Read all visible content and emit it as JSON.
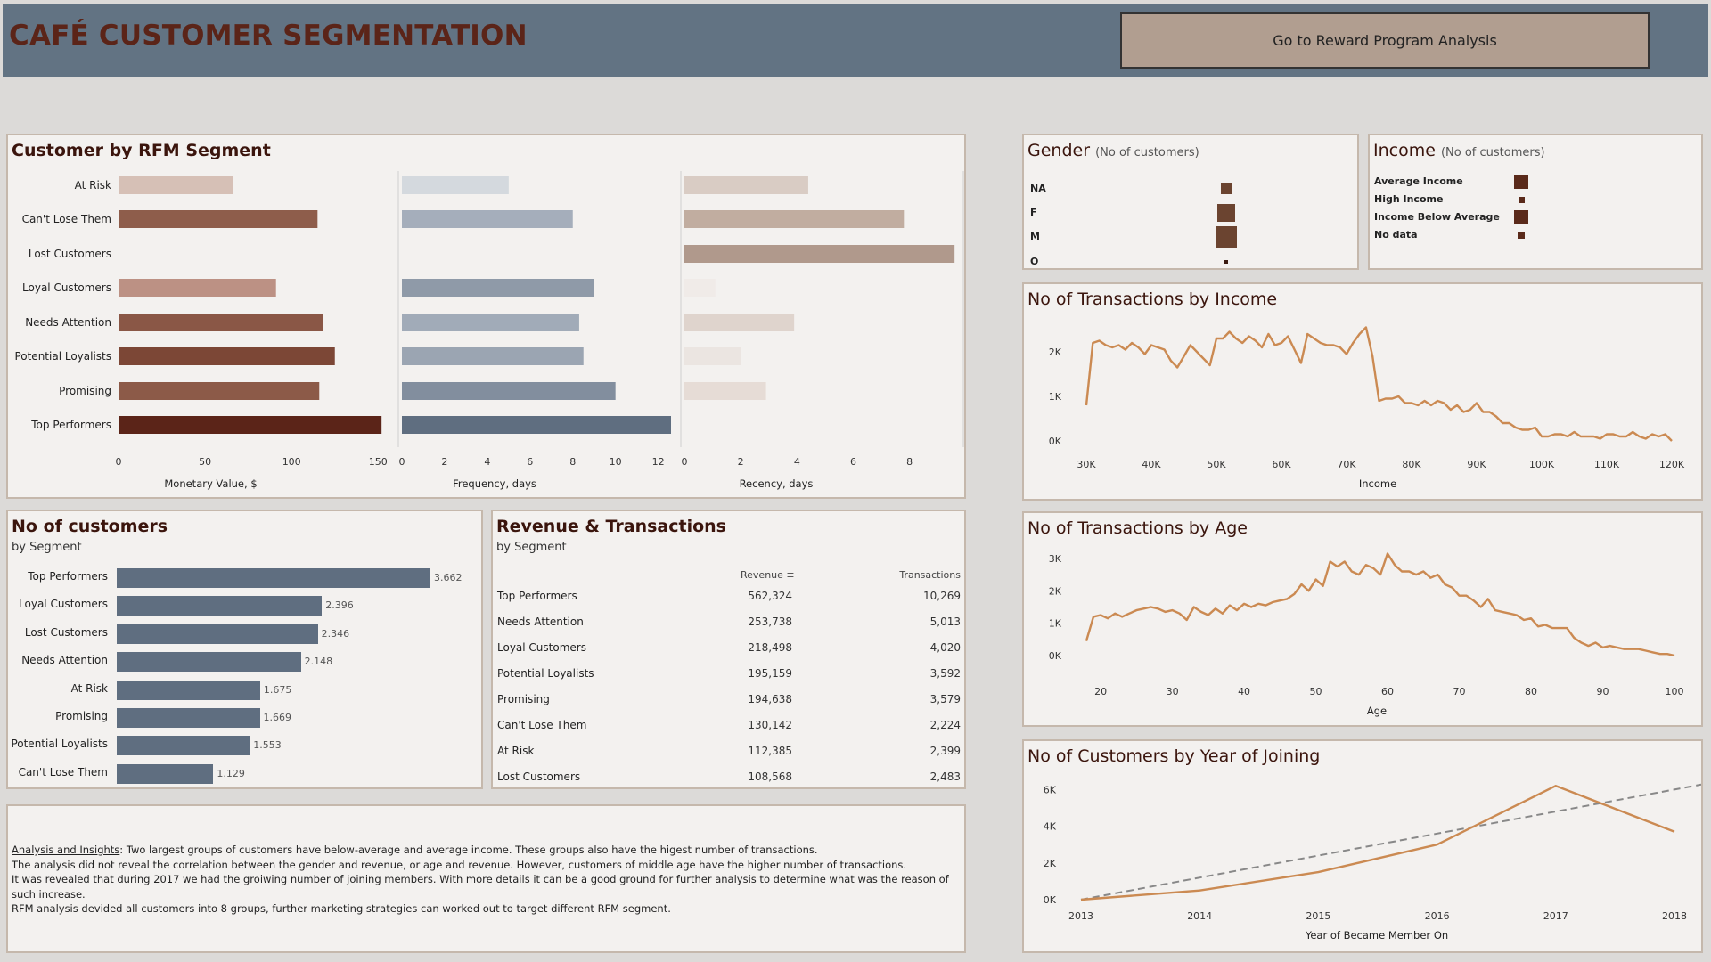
{
  "header": {
    "title": "CAFÉ CUSTOMER SEGMENTATION",
    "nav_button": "Go to Reward Program Analysis"
  },
  "rfm": {
    "title": "Customer by RFM Segment",
    "segments": [
      "At Risk",
      "Can't Lose Them",
      "Lost Customers",
      "Loyal Customers",
      "Needs Attention",
      "Potential Loyalists",
      "Promising",
      "Top Performers"
    ],
    "monetary": [
      66,
      115,
      0,
      91,
      118,
      125,
      116,
      152
    ],
    "frequency": [
      5,
      8,
      0,
      9,
      8.3,
      8.5,
      10,
      12.6
    ],
    "recency": [
      4.4,
      7.8,
      9.6,
      1.1,
      3.9,
      2,
      2.9,
      0
    ],
    "monetary_colors": [
      "#d6c0b6",
      "#8e5d4b",
      "#f3f1ef",
      "#bc9184",
      "#8a5746",
      "#7c4736",
      "#8c5a48",
      "#5b2418"
    ],
    "frequency_colors": [
      "#d4d9de",
      "#a5aebb",
      "#f3f1ef",
      "#8f9aa8",
      "#a1abb8",
      "#9ba5b2",
      "#828e9e",
      "#5f6e80"
    ],
    "recency_colors": [
      "#d9ccc4",
      "#c1ada0",
      "#b0998c",
      "#f0ebe8",
      "#dfd4cd",
      "#ebe5e1",
      "#e6dcd6",
      "#f3f1ef"
    ],
    "monetary_ticks": [
      "0",
      "50",
      "100",
      "150"
    ],
    "frequency_ticks": [
      "0",
      "2",
      "4",
      "6",
      "8",
      "10",
      "12"
    ],
    "recency_ticks": [
      "0",
      "2",
      "4",
      "6",
      "8"
    ],
    "monetary_label": "Monetary Value, $",
    "frequency_label": "Frequency, days",
    "recency_label": "Recency, days"
  },
  "gender": {
    "title": "Gender",
    "subtitle": "(No of customers)",
    "labels": [
      "NA",
      "F",
      "M",
      "O"
    ],
    "sizes": [
      12,
      20,
      24,
      4
    ]
  },
  "income": {
    "title": "Income",
    "subtitle": "(No of customers)",
    "labels": [
      "Average Income",
      "High Income",
      "Income Below Average",
      "No data"
    ],
    "sizes": [
      16,
      7,
      16,
      8
    ]
  },
  "tx_income": {
    "title": "No of Transactions by Income",
    "xlabel": "Income",
    "x_ticks": [
      "30K",
      "40K",
      "50K",
      "60K",
      "70K",
      "80K",
      "90K",
      "100K",
      "110K",
      "120K"
    ],
    "y_ticks": [
      "2K",
      "1K",
      "0K"
    ]
  },
  "tx_age": {
    "title": "No of Transactions by Age",
    "xlabel": "Age",
    "x_ticks": [
      "20",
      "30",
      "40",
      "50",
      "60",
      "70",
      "80",
      "90",
      "100"
    ],
    "y_ticks": [
      "3K",
      "2K",
      "1K",
      "0K"
    ]
  },
  "year_join": {
    "title": "No of Customers by Year of Joining",
    "xlabel": "Year of Became Member On",
    "x_ticks": [
      "2013",
      "2014",
      "2015",
      "2016",
      "2017",
      "2018"
    ],
    "y_ticks": [
      "6K",
      "4K",
      "2K",
      "0K"
    ]
  },
  "customers": {
    "title": "No of customers",
    "subtitle": "by Segment",
    "rows": [
      {
        "label": "Top Performers",
        "value": "3.662"
      },
      {
        "label": "Loyal Customers",
        "value": "2.396"
      },
      {
        "label": "Lost Customers",
        "value": "2.346"
      },
      {
        "label": "Needs Attention",
        "value": "2.148"
      },
      {
        "label": "At Risk",
        "value": "1.675"
      },
      {
        "label": "Promising",
        "value": "1.669"
      },
      {
        "label": "Potential Loyalists",
        "value": "1.553"
      },
      {
        "label": "Can't Lose Them",
        "value": "1.129"
      }
    ],
    "fractions": [
      1.0,
      0.654,
      0.641,
      0.587,
      0.457,
      0.456,
      0.424,
      0.308
    ]
  },
  "revenue": {
    "title": "Revenue & Transactions",
    "subtitle": "by Segment",
    "col_revenue": "Revenue",
    "col_transactions": "Transactions",
    "rows": [
      {
        "segment": "Top Performers",
        "revenue": "562,324",
        "transactions": "10,269"
      },
      {
        "segment": "Needs Attention",
        "revenue": "253,738",
        "transactions": "5,013"
      },
      {
        "segment": "Loyal Customers",
        "revenue": "218,498",
        "transactions": "4,020"
      },
      {
        "segment": "Potential Loyalists",
        "revenue": "195,159",
        "transactions": "3,592"
      },
      {
        "segment": "Promising",
        "revenue": "194,638",
        "transactions": "3,579"
      },
      {
        "segment": "Can't Lose Them",
        "revenue": "130,142",
        "transactions": "2,224"
      },
      {
        "segment": "At Risk",
        "revenue": "112,385",
        "transactions": "2,399"
      },
      {
        "segment": "Lost Customers",
        "revenue": "108,568",
        "transactions": "2,483"
      }
    ]
  },
  "insights": {
    "heading": "Analysis and Insights",
    "line1": ": Two largest groups of customers have below-average and average income. These groups also have the higest number of transactions.",
    "line2": "The analysis did not reveal the correlation between the gender and revenue, or age and revenue. However, customers of middle age have the higher number of transactions.",
    "line3": "It was revealed that during 2017 we had the groiwing number of joining members. With more details it can be a good ground for further analysis to determine what was the reason of such increase.",
    "line4": "RFM analysis devided all customers into 8 groups, further marketing strategies can worked out to target different RFM segment."
  },
  "chart_data": [
    {
      "type": "line",
      "title": "No of Transactions by Income",
      "xlabel": "Income",
      "x": [
        30000,
        31000,
        32000,
        33000,
        34000,
        35000,
        36000,
        37000,
        38000,
        39000,
        40000,
        41000,
        42000,
        43000,
        44000,
        45000,
        46000,
        47000,
        48000,
        49000,
        50000,
        51000,
        52000,
        53000,
        54000,
        55000,
        56000,
        57000,
        58000,
        59000,
        60000,
        61000,
        62000,
        63000,
        64000,
        65000,
        66000,
        67000,
        68000,
        69000,
        70000,
        71000,
        72000,
        73000,
        74000,
        75000,
        76000,
        77000,
        78000,
        79000,
        80000,
        81000,
        82000,
        83000,
        84000,
        85000,
        86000,
        87000,
        88000,
        89000,
        90000,
        91000,
        92000,
        93000,
        94000,
        95000,
        96000,
        97000,
        98000,
        99000,
        100000,
        101000,
        102000,
        103000,
        104000,
        105000,
        106000,
        107000,
        108000,
        109000,
        110000,
        111000,
        112000,
        113000,
        114000,
        115000,
        116000,
        117000,
        118000,
        119000,
        120000
      ],
      "y": [
        800,
        2200,
        2250,
        2150,
        2100,
        2150,
        2050,
        2200,
        2100,
        1950,
        2150,
        2100,
        2050,
        1800,
        1650,
        1900,
        2150,
        2000,
        1850,
        1700,
        2300,
        2300,
        2450,
        2300,
        2200,
        2350,
        2250,
        2100,
        2400,
        2150,
        2200,
        2350,
        2050,
        1750,
        2400,
        2300,
        2200,
        2150,
        2150,
        2100,
        1950,
        2200,
        2400,
        2550,
        1900,
        900,
        950,
        950,
        1000,
        850,
        850,
        800,
        900,
        800,
        900,
        850,
        700,
        800,
        650,
        700,
        850,
        650,
        650,
        550,
        400,
        400,
        300,
        250,
        250,
        300,
        100,
        100,
        150,
        150,
        100,
        200,
        100,
        100,
        100,
        50,
        150,
        150,
        100,
        100,
        200,
        100,
        50,
        150,
        100,
        150,
        0
      ],
      "ylim": [
        0,
        2800
      ]
    },
    {
      "type": "line",
      "title": "No of Transactions by Age",
      "xlabel": "Age",
      "x": [
        18,
        19,
        20,
        21,
        22,
        23,
        24,
        25,
        26,
        27,
        28,
        29,
        30,
        31,
        32,
        33,
        34,
        35,
        36,
        37,
        38,
        39,
        40,
        41,
        42,
        43,
        44,
        45,
        46,
        47,
        48,
        49,
        50,
        51,
        52,
        53,
        54,
        55,
        56,
        57,
        58,
        59,
        60,
        61,
        62,
        63,
        64,
        65,
        66,
        67,
        68,
        69,
        70,
        71,
        72,
        73,
        74,
        75,
        76,
        77,
        78,
        79,
        80,
        81,
        82,
        83,
        84,
        85,
        86,
        87,
        88,
        89,
        90,
        91,
        92,
        93,
        94,
        95,
        96,
        97,
        98,
        99,
        100
      ],
      "y": [
        450,
        1200,
        1250,
        1150,
        1300,
        1200,
        1300,
        1400,
        1450,
        1500,
        1450,
        1350,
        1400,
        1300,
        1100,
        1500,
        1350,
        1250,
        1450,
        1300,
        1550,
        1400,
        1600,
        1500,
        1600,
        1550,
        1650,
        1700,
        1750,
        1900,
        2200,
        2000,
        2350,
        2150,
        2900,
        2750,
        2900,
        2600,
        2500,
        2800,
        2700,
        2500,
        3150,
        2800,
        2600,
        2600,
        2500,
        2600,
        2400,
        2500,
        2200,
        2100,
        1850,
        1850,
        1700,
        1500,
        1750,
        1400,
        1350,
        1300,
        1250,
        1100,
        1150,
        900,
        950,
        850,
        850,
        850,
        550,
        400,
        300,
        400,
        250,
        300,
        250,
        200,
        200,
        200,
        150,
        100,
        50,
        50,
        0
      ],
      "ylim": [
        0,
        3300
      ]
    },
    {
      "type": "line",
      "title": "No of Customers by Year of Joining",
      "xlabel": "Year of Became Member On",
      "x": [
        2013,
        2014,
        2015,
        2016,
        2017,
        2018
      ],
      "y": [
        0,
        500,
        1500,
        3000,
        6200,
        3700
      ],
      "trend_start": 0,
      "trend_end": 5600,
      "ylim": [
        0,
        6600
      ]
    }
  ],
  "colors": {
    "accent": "#cb8a52",
    "header": "#627383",
    "title": "#5b2418",
    "seg_bar": "#5f6e80"
  }
}
